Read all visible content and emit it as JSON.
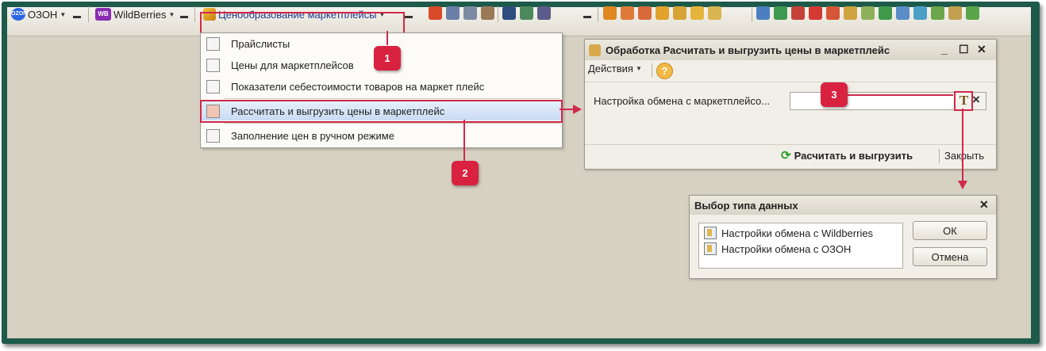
{
  "toolbar": {
    "ozon_label": "ОЗОН",
    "ozon_logo": "OZON",
    "wb_label": "WildBerries",
    "wb_logo": "WB",
    "pricing_label": "Ценообразование маркетплейсы"
  },
  "menu": {
    "items": [
      {
        "label": "Прайслисты"
      },
      {
        "label": "Цены для маркетплейсов"
      },
      {
        "label": "Показатели себестоимости товаров на маркет плейс"
      },
      {
        "label": "Рассчитать и выгрузить цены в маркетплейс"
      },
      {
        "label": "Заполнение цен в ручном режиме"
      }
    ]
  },
  "badges": [
    "1",
    "2",
    "3"
  ],
  "processing_dialog": {
    "title": "Обработка  Расчитать и выгрузить цены в маркетплейс",
    "actions_label": "Действия",
    "help_glyph": "?",
    "field_label": "Настройка обмена с маркетплейсо...",
    "field_value": "",
    "type_button_glyph": "T",
    "clear_glyph": "×",
    "calc_button": "Расчитать и выгрузить",
    "close_button": "Закрыть"
  },
  "type_dialog": {
    "title": "Выбор типа данных",
    "items": [
      {
        "label": "Настройки обмена с Wildberries"
      },
      {
        "label": "Настройки обмена с ОЗОН"
      }
    ],
    "ok_button": "ОК",
    "cancel_button": "Отмена"
  },
  "colors": {
    "frame": "#1d5a49",
    "desktop": "#d6d1c2",
    "callout": "#d8223f"
  }
}
